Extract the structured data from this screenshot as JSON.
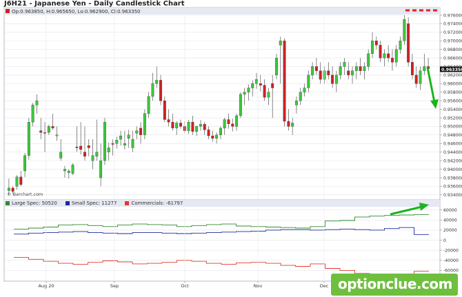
{
  "header": {
    "title": "J6H21 - Japanese Yen - Daily Candlestick Chart",
    "ohlc": "Op:0.963850, H:0.965650, Lo:0.962900, Cl:0.963350",
    "credit": "© Barchart.com"
  },
  "watermark": "optionclue.com",
  "colors": {
    "up_candle": "#3cc63c",
    "down_candle": "#cc2222",
    "large_spec": "#2e8b2e",
    "small_spec": "#1a2a9a",
    "commercials": "#e03a2a",
    "arrow": "#1db31d",
    "dashed_level": "#e02020",
    "last_price_tag": "#111111"
  },
  "chart_data": [
    {
      "type": "candlestick",
      "title": "J6H21 - Japanese Yen - Daily Candlestick Chart",
      "x_tick_labels": [
        "Aug 20",
        "Sep",
        "Oct",
        "Nov",
        "Dec"
      ],
      "y_tick_labels": [
        "0.976000",
        "0.974000",
        "0.972000",
        "0.970000",
        "0.968000",
        "0.966000",
        "0.964000",
        "0.962000",
        "0.960000",
        "0.958000",
        "0.956000",
        "0.954000",
        "0.952000",
        "0.950000",
        "0.948000",
        "0.946000",
        "0.944000",
        "0.942000",
        "0.940000",
        "0.938000",
        "0.936000",
        "0.934000"
      ],
      "ylim": [
        0.933,
        0.976
      ],
      "last_price": "0.963350",
      "grid": true,
      "annotations": [
        "dashed resistance line near 0.9755",
        "green arrow pointing down from latest candles"
      ],
      "candles": [
        [
          0.935,
          0.9378,
          0.934,
          0.9356
        ],
        [
          0.9356,
          0.936,
          0.9342,
          0.9348
        ],
        [
          0.936,
          0.9386,
          0.9352,
          0.9382
        ],
        [
          0.9382,
          0.9396,
          0.936,
          0.9364
        ],
        [
          0.9396,
          0.9438,
          0.9382,
          0.9432
        ],
        [
          0.9432,
          0.952,
          0.9422,
          0.951
        ],
        [
          0.951,
          0.9555,
          0.95,
          0.955
        ],
        [
          0.955,
          0.9575,
          0.953,
          0.956
        ],
        [
          0.949,
          0.952,
          0.947,
          0.9486
        ],
        [
          0.9486,
          0.951,
          0.944,
          0.9484
        ],
        [
          0.9486,
          0.9504,
          0.948,
          0.95
        ],
        [
          0.95,
          0.953,
          0.9492,
          0.9496
        ],
        [
          0.9478,
          0.95,
          0.9466,
          0.948
        ],
        [
          0.9426,
          0.947,
          0.942,
          0.944
        ],
        [
          0.9396,
          0.9408,
          0.938,
          0.94
        ],
        [
          0.9392,
          0.94,
          0.9378,
          0.9396
        ],
        [
          0.939,
          0.9414,
          0.9386,
          0.941
        ],
        [
          0.9452,
          0.95,
          0.944,
          0.945
        ],
        [
          0.9454,
          0.951,
          0.9434,
          0.9446
        ],
        [
          0.944,
          0.95,
          0.942,
          0.943
        ],
        [
          0.9455,
          0.947,
          0.943,
          0.945
        ],
        [
          0.942,
          0.947,
          0.94,
          0.9432
        ],
        [
          0.943,
          0.9516,
          0.942,
          0.944
        ],
        [
          0.938,
          0.946,
          0.936,
          0.942
        ],
        [
          0.942,
          0.952,
          0.941,
          0.951
        ],
        [
          0.944,
          0.9462,
          0.942,
          0.945
        ],
        [
          0.946,
          0.947,
          0.9432,
          0.9458
        ],
        [
          0.946,
          0.9476,
          0.9448,
          0.9468
        ],
        [
          0.947,
          0.949,
          0.9455,
          0.9478
        ],
        [
          0.9456,
          0.949,
          0.9446,
          0.946
        ],
        [
          0.9472,
          0.9492,
          0.945,
          0.948
        ],
        [
          0.945,
          0.949,
          0.944,
          0.947
        ],
        [
          0.9484,
          0.95,
          0.947,
          0.949
        ],
        [
          0.9496,
          0.951,
          0.946,
          0.948
        ],
        [
          0.948,
          0.954,
          0.947,
          0.953
        ],
        [
          0.953,
          0.958,
          0.952,
          0.957
        ],
        [
          0.957,
          0.9625,
          0.956,
          0.96
        ],
        [
          0.96,
          0.964,
          0.959,
          0.9608
        ],
        [
          0.9608,
          0.962,
          0.955,
          0.956
        ],
        [
          0.956,
          0.957,
          0.951,
          0.9516
        ],
        [
          0.9516,
          0.954,
          0.95,
          0.951
        ],
        [
          0.951,
          0.953,
          0.949,
          0.9496
        ],
        [
          0.9496,
          0.9512,
          0.948,
          0.9508
        ],
        [
          0.9508,
          0.9516,
          0.9495,
          0.95
        ],
        [
          0.95,
          0.9512,
          0.9484,
          0.949
        ],
        [
          0.949,
          0.9515,
          0.9482,
          0.951
        ],
        [
          0.951,
          0.9525,
          0.948,
          0.9488
        ],
        [
          0.9488,
          0.9502,
          0.9478,
          0.95
        ],
        [
          0.95,
          0.9515,
          0.949,
          0.9505
        ],
        [
          0.9505,
          0.951,
          0.948,
          0.9492
        ],
        [
          0.9492,
          0.95,
          0.947,
          0.9478
        ],
        [
          0.9478,
          0.949,
          0.9464,
          0.9472
        ],
        [
          0.9472,
          0.9486,
          0.946,
          0.948
        ],
        [
          0.948,
          0.95,
          0.947,
          0.9496
        ],
        [
          0.9496,
          0.952,
          0.948,
          0.9516
        ],
        [
          0.9516,
          0.953,
          0.9495,
          0.9506
        ],
        [
          0.9506,
          0.9518,
          0.9488,
          0.95
        ],
        [
          0.95,
          0.953,
          0.949,
          0.9525
        ],
        [
          0.9525,
          0.958,
          0.952,
          0.9575
        ],
        [
          0.9575,
          0.959,
          0.955,
          0.958
        ],
        [
          0.958,
          0.9598,
          0.956,
          0.959
        ],
        [
          0.959,
          0.9608,
          0.957,
          0.96
        ],
        [
          0.96,
          0.9625,
          0.9588,
          0.961
        ],
        [
          0.96,
          0.962,
          0.9582,
          0.9596
        ],
        [
          0.9596,
          0.961,
          0.956,
          0.9568
        ],
        [
          0.9568,
          0.959,
          0.955,
          0.958
        ],
        [
          0.96,
          0.962,
          0.952,
          0.959
        ],
        [
          0.962,
          0.967,
          0.961,
          0.966
        ],
        [
          0.969,
          0.971,
          0.96,
          0.97
        ],
        [
          0.97,
          0.9706,
          0.95,
          0.9512
        ],
        [
          0.9512,
          0.954,
          0.949,
          0.95
        ],
        [
          0.95,
          0.952,
          0.948,
          0.9508
        ],
        [
          0.955,
          0.957,
          0.953,
          0.956
        ],
        [
          0.956,
          0.959,
          0.955,
          0.958
        ],
        [
          0.958,
          0.96,
          0.957,
          0.959
        ],
        [
          0.959,
          0.963,
          0.958,
          0.962
        ],
        [
          0.962,
          0.965,
          0.961,
          0.964
        ],
        [
          0.964,
          0.966,
          0.962,
          0.963
        ],
        [
          0.963,
          0.965,
          0.96,
          0.961
        ],
        [
          0.961,
          0.964,
          0.96,
          0.963
        ],
        [
          0.963,
          0.965,
          0.961,
          0.962
        ],
        [
          0.962,
          0.964,
          0.959,
          0.96
        ],
        [
          0.96,
          0.963,
          0.958,
          0.962
        ],
        [
          0.962,
          0.965,
          0.961,
          0.964
        ],
        [
          0.964,
          0.966,
          0.962,
          0.965
        ],
        [
          0.963,
          0.965,
          0.961,
          0.962
        ],
        [
          0.962,
          0.964,
          0.96,
          0.963
        ],
        [
          0.963,
          0.965,
          0.961,
          0.964
        ],
        [
          0.964,
          0.966,
          0.962,
          0.963
        ],
        [
          0.963,
          0.965,
          0.961,
          0.964
        ],
        [
          0.964,
          0.968,
          0.963,
          0.967
        ],
        [
          0.967,
          0.972,
          0.966,
          0.97
        ],
        [
          0.97,
          0.971,
          0.968,
          0.969
        ],
        [
          0.969,
          0.97,
          0.965,
          0.966
        ],
        [
          0.966,
          0.968,
          0.964,
          0.967
        ],
        [
          0.967,
          0.969,
          0.965,
          0.966
        ],
        [
          0.966,
          0.968,
          0.963,
          0.965
        ],
        [
          0.965,
          0.969,
          0.964,
          0.968
        ],
        [
          0.968,
          0.971,
          0.967,
          0.97
        ],
        [
          0.97,
          0.976,
          0.969,
          0.975
        ],
        [
          0.974,
          0.9755,
          0.964,
          0.965
        ],
        [
          0.965,
          0.967,
          0.961,
          0.962
        ],
        [
          0.962,
          0.964,
          0.959,
          0.96
        ],
        [
          0.96,
          0.964,
          0.9585,
          0.963
        ],
        [
          0.963,
          0.967,
          0.962,
          0.964
        ],
        [
          0.964,
          0.966,
          0.9625,
          0.9635
        ]
      ]
    },
    {
      "type": "line",
      "title": "",
      "legend_position": "top-left",
      "legend": [
        {
          "name": "Large Spec",
          "value": "50520"
        },
        {
          "name": "Small Spec",
          "value": "11277"
        },
        {
          "name": "Commercials",
          "value": "-61797"
        }
      ],
      "y_tick_labels": [
        "60000",
        "40000",
        "20000",
        "0",
        "-20000",
        "-40000",
        "-60000"
      ],
      "ylim": [
        -80000,
        65000
      ],
      "x_tick_labels": [
        "Aug 20",
        "Sep",
        "Oct",
        "Nov",
        "Dec"
      ],
      "grid": true,
      "series": [
        {
          "name": "Large Spec",
          "values": [
            22000,
            24000,
            26000,
            30000,
            31000,
            29000,
            27000,
            30000,
            32000,
            31000,
            30000,
            27000,
            29000,
            31000,
            32000,
            28000,
            27000,
            26000,
            25000,
            24000,
            27000,
            38000,
            39000,
            46000,
            48000,
            49000,
            50000,
            50520
          ]
        },
        {
          "name": "Small Spec",
          "values": [
            12000,
            14000,
            15000,
            16000,
            17000,
            15000,
            14000,
            13000,
            15000,
            15000,
            14000,
            13000,
            14000,
            15000,
            16000,
            17000,
            18000,
            20000,
            21000,
            21000,
            20000,
            21000,
            22000,
            21000,
            20000,
            23000,
            25000,
            11277
          ]
        },
        {
          "name": "Commercials",
          "values": [
            -34000,
            -38000,
            -42000,
            -46000,
            -48000,
            -44000,
            -41000,
            -43000,
            -47000,
            -46000,
            -44000,
            -40000,
            -42000,
            -46000,
            -48000,
            -45000,
            -44000,
            -46000,
            -50000,
            -52000,
            -47000,
            -56000,
            -60000,
            -66000,
            -68000,
            -70000,
            -72000,
            -61797
          ]
        }
      ]
    }
  ]
}
